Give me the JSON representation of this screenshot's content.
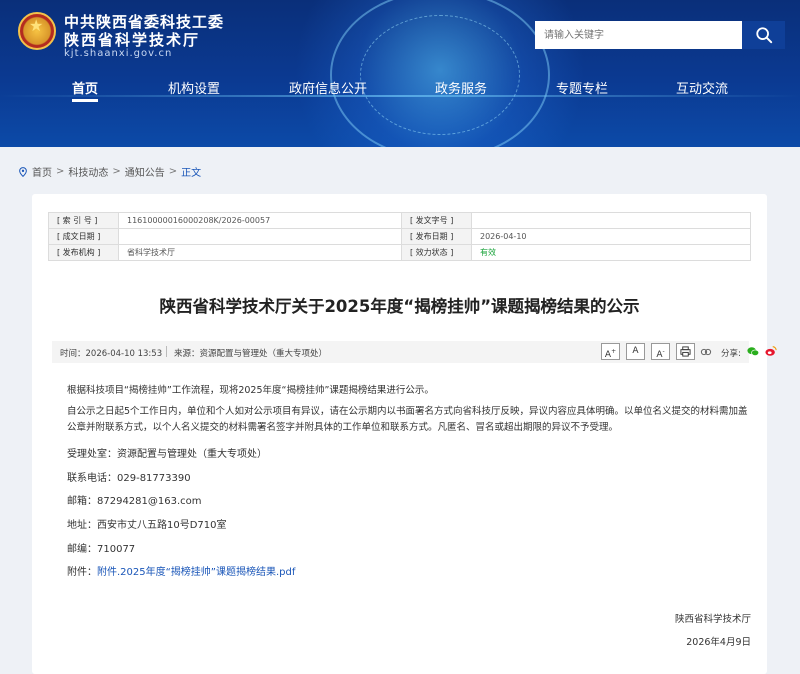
{
  "header": {
    "org_line1": "中共陕西省委科技工委",
    "org_line2": "陕西省科学技术厅",
    "site_url": "kjt.shaanxi.gov.cn",
    "search_placeholder": "请输入关键字"
  },
  "nav": [
    "首页",
    "机构设置",
    "政府信息公开",
    "政务服务",
    "专题专栏",
    "互动交流"
  ],
  "breadcrumb": {
    "items": [
      "首页",
      "科技动态",
      "通知公告"
    ],
    "current": "正文",
    "separator": ">"
  },
  "meta": {
    "index_label": "[ 索 引 号 ]",
    "index_value": "11610000016000208K/2026-00057",
    "doc_no_label": "[ 发文字号 ]",
    "doc_no_value": "",
    "created_label": "[ 成文日期 ]",
    "created_value": "",
    "published_label": "[ 发布日期 ]",
    "published_value": "2026-04-10",
    "issuer_label": "[ 发布机构 ]",
    "issuer_value": "省科学技术厅",
    "status_label": "[ 效力状态 ]",
    "status_value": "有效"
  },
  "article": {
    "title": "陕西省科学技术厅关于2025年度“揭榜挂帅”课题揭榜结果的公示",
    "time": "时间：2026-04-10 13:53",
    "source": "来源：资源配置与管理处（重大专项处）",
    "font_buttons": [
      "A",
      "A",
      "A"
    ],
    "share_label": "分享:",
    "para1": "根据科技项目“揭榜挂帅”工作流程，现将2025年度“揭榜挂帅”课题揭榜结果进行公示。",
    "para2": "自公示之日起5个工作日内，单位和个人如对公示项目有异议，请在公示期内以书面署名方式向省科技厅反映，异议内容应具体明确。以单位名义提交的材料需加盖公章并附联系方式，以个人名义提交的材料需署名签字并附具体的工作单位和联系方式。凡匿名、冒名或超出期限的异议不予受理。",
    "dept": "受理处室：资源配置与管理处（重大专项处）",
    "phone": "联系电话：029-81773390",
    "email": "邮箱：87294281@163.com",
    "address": "地址：西安市丈八五路10号D710室",
    "postcode": "邮编：710077",
    "attachment_label": "附件：",
    "attachment_link": "附件.2025年度“揭榜挂帅”课题揭榜结果.pdf",
    "signature": "陕西省科学技术厅",
    "date": "2026年4月9日"
  }
}
